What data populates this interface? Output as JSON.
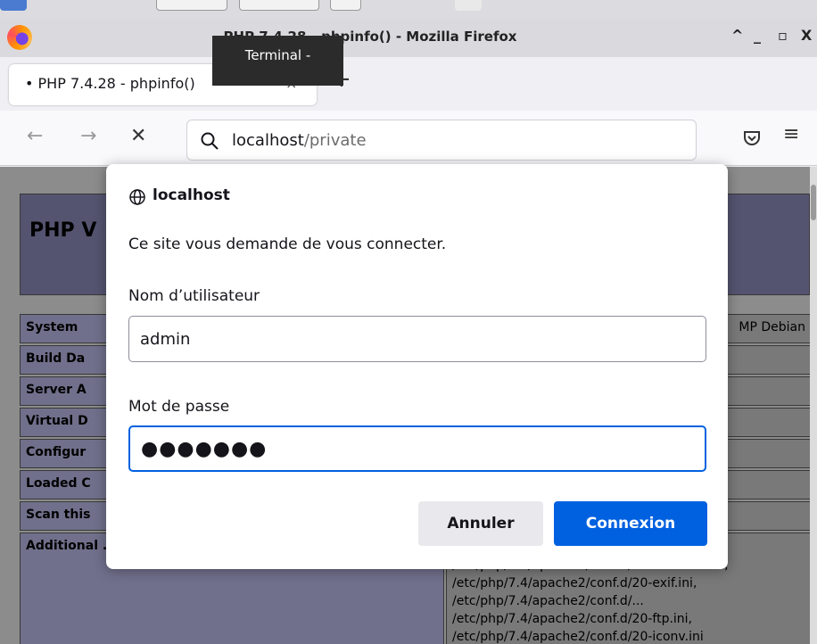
{
  "window": {
    "title": "PHP 7.4.28 - phpinfo() - Mozilla Firefox",
    "minimize": "_",
    "maximize": "▫",
    "collapse": "^",
    "close": "X"
  },
  "tooltip": {
    "text": "Terminal -"
  },
  "tabs": [
    {
      "label": "• PHP 7.4.28 - phpinfo()",
      "close": "×"
    }
  ],
  "newtab": "+",
  "nav": {
    "back": "←",
    "forward": "→",
    "stop": "✕",
    "url_host": "localhost",
    "url_path": "/private",
    "menu": "≡"
  },
  "page": {
    "php_title": "PHP V",
    "rows": [
      {
        "key": "System",
        "value": "MP Debian"
      },
      {
        "key": "Build Da",
        "value": ""
      },
      {
        "key": "Server A",
        "value": ""
      },
      {
        "key": "Virtual D",
        "value": ""
      },
      {
        "key": "Configur",
        "value": ""
      },
      {
        "key": "Loaded C",
        "value": ""
      },
      {
        "key": "Scan this",
        "value": ""
      },
      {
        "key": "Additional .ini files parsed",
        "value": "/etc/php/7.4/apache2/conf.d/10-opcache.ini, /etc/php/7.4/apache2/conf.d/20-calendar.ini, /etc/php/7.4/apache2/conf.d/20-exif.ini, /etc/php/7.4/apache2/conf.d/... /etc/php/7.4/apache2/conf.d/20-ftp.ini, /etc/php/7.4/apache2/conf.d/20-iconv.ini"
      }
    ]
  },
  "dialog": {
    "host": "localhost",
    "message": "Ce site vous demande de vous connecter.",
    "username_label": "Nom d’utilisateur",
    "username_value": "admin",
    "password_label": "Mot de passe",
    "password_value": "●●●●●●●",
    "cancel_label": "Annuler",
    "connect_label": "Connexion"
  },
  "colors": {
    "accent": "#0061e0",
    "php_header": "#9999cc",
    "php_key": "#ccccff"
  }
}
